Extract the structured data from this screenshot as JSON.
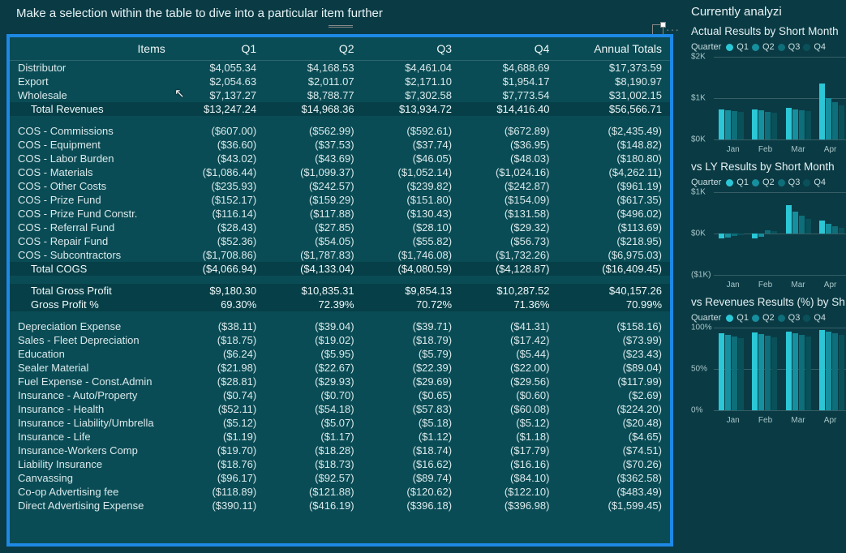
{
  "title_bar": {
    "instruction": "Make a selection within the table to dive into a particular item further"
  },
  "table": {
    "headers": [
      "Items",
      "Q1",
      "Q2",
      "Q3",
      "Q4",
      "Annual Totals"
    ],
    "sections": [
      {
        "rows": [
          {
            "label": "Distributor",
            "v": [
              "$4,055.34",
              "$4,168.53",
              "$4,461.04",
              "$4,688.69",
              "$17,373.59"
            ]
          },
          {
            "label": "Export",
            "v": [
              "$2,054.63",
              "$2,011.07",
              "$2,171.10",
              "$1,954.17",
              "$8,190.97"
            ]
          },
          {
            "label": "Wholesale",
            "v": [
              "$7,137.27",
              "$8,788.77",
              "$7,302.58",
              "$7,773.54",
              "$31,002.15"
            ]
          }
        ],
        "subtotal": {
          "label": "Total Revenues",
          "v": [
            "$13,247.24",
            "$14,968.36",
            "$13,934.72",
            "$14,416.40",
            "$56,566.71"
          ]
        }
      },
      {
        "rows": [
          {
            "label": "COS - Commissions",
            "v": [
              "($607.00)",
              "($562.99)",
              "($592.61)",
              "($672.89)",
              "($2,435.49)"
            ]
          },
          {
            "label": "COS - Equipment",
            "v": [
              "($36.60)",
              "($37.53)",
              "($37.74)",
              "($36.95)",
              "($148.82)"
            ]
          },
          {
            "label": "COS - Labor Burden",
            "v": [
              "($43.02)",
              "($43.69)",
              "($46.05)",
              "($48.03)",
              "($180.80)"
            ]
          },
          {
            "label": "COS - Materials",
            "v": [
              "($1,086.44)",
              "($1,099.37)",
              "($1,052.14)",
              "($1,024.16)",
              "($4,262.11)"
            ]
          },
          {
            "label": "COS - Other Costs",
            "v": [
              "($235.93)",
              "($242.57)",
              "($239.82)",
              "($242.87)",
              "($961.19)"
            ]
          },
          {
            "label": "COS - Prize Fund",
            "v": [
              "($152.17)",
              "($159.29)",
              "($151.80)",
              "($154.09)",
              "($617.35)"
            ]
          },
          {
            "label": "COS - Prize Fund Constr.",
            "v": [
              "($116.14)",
              "($117.88)",
              "($130.43)",
              "($131.58)",
              "($496.02)"
            ]
          },
          {
            "label": "COS - Referral Fund",
            "v": [
              "($28.43)",
              "($27.85)",
              "($28.10)",
              "($29.32)",
              "($113.69)"
            ]
          },
          {
            "label": "COS - Repair Fund",
            "v": [
              "($52.36)",
              "($54.05)",
              "($55.82)",
              "($56.73)",
              "($218.95)"
            ]
          },
          {
            "label": "COS - Subcontractors",
            "v": [
              "($1,708.86)",
              "($1,787.83)",
              "($1,746.08)",
              "($1,732.26)",
              "($6,975.03)"
            ]
          }
        ],
        "subtotal": {
          "label": "Total COGS",
          "v": [
            "($4,066.94)",
            "($4,133.04)",
            "($4,080.59)",
            "($4,128.87)",
            "($16,409.45)"
          ]
        }
      },
      {
        "rows": [],
        "subtotal": {
          "label": "Total Gross Profit",
          "v": [
            "$9,180.30",
            "$10,835.31",
            "$9,854.13",
            "$10,287.52",
            "$40,157.26"
          ]
        },
        "extra": {
          "label": "Gross Profit %",
          "v": [
            "69.30%",
            "72.39%",
            "70.72%",
            "71.36%",
            "70.99%"
          ]
        }
      },
      {
        "rows": [
          {
            "label": "Depreciation Expense",
            "v": [
              "($38.11)",
              "($39.04)",
              "($39.71)",
              "($41.31)",
              "($158.16)"
            ]
          },
          {
            "label": "Sales - Fleet Depreciation",
            "v": [
              "($18.75)",
              "($19.02)",
              "($18.79)",
              "($17.42)",
              "($73.99)"
            ]
          },
          {
            "label": "Education",
            "v": [
              "($6.24)",
              "($5.95)",
              "($5.79)",
              "($5.44)",
              "($23.43)"
            ]
          },
          {
            "label": "Sealer Material",
            "v": [
              "($21.98)",
              "($22.67)",
              "($22.39)",
              "($22.00)",
              "($89.04)"
            ]
          },
          {
            "label": "Fuel Expense - Const.Admin",
            "v": [
              "($28.81)",
              "($29.93)",
              "($29.69)",
              "($29.56)",
              "($117.99)"
            ]
          },
          {
            "label": "Insurance - Auto/Property",
            "v": [
              "($0.74)",
              "($0.70)",
              "($0.65)",
              "($0.60)",
              "($2.69)"
            ]
          },
          {
            "label": "Insurance - Health",
            "v": [
              "($52.11)",
              "($54.18)",
              "($57.83)",
              "($60.08)",
              "($224.20)"
            ]
          },
          {
            "label": "Insurance - Liability/Umbrella",
            "v": [
              "($5.12)",
              "($5.07)",
              "($5.18)",
              "($5.12)",
              "($20.48)"
            ]
          },
          {
            "label": "Insurance - Life",
            "v": [
              "($1.19)",
              "($1.17)",
              "($1.12)",
              "($1.18)",
              "($4.65)"
            ]
          },
          {
            "label": "Insurance-Workers Comp",
            "v": [
              "($19.70)",
              "($18.28)",
              "($18.74)",
              "($17.79)",
              "($74.51)"
            ]
          },
          {
            "label": "Liability Insurance",
            "v": [
              "($18.76)",
              "($18.73)",
              "($16.62)",
              "($16.16)",
              "($70.26)"
            ]
          },
          {
            "label": "Canvassing",
            "v": [
              "($96.17)",
              "($92.57)",
              "($89.74)",
              "($84.10)",
              "($362.58)"
            ]
          },
          {
            "label": "Co-op Advertising fee",
            "v": [
              "($118.89)",
              "($121.88)",
              "($120.62)",
              "($122.10)",
              "($483.49)"
            ]
          },
          {
            "label": "Direct Advertising Expense",
            "v": [
              "($390.11)",
              "($416.19)",
              "($396.18)",
              "($396.98)",
              "($1,599.45)"
            ]
          }
        ]
      }
    ]
  },
  "right": {
    "title": "Currently analyzi",
    "legend_label": "Quarter",
    "quarters": [
      "Q1",
      "Q2",
      "Q3",
      "Q4"
    ],
    "months": [
      "Jan",
      "Feb",
      "Mar",
      "Apr"
    ],
    "charts": [
      {
        "title": "Actual Results by Short Month",
        "yticks": [
          "$2K",
          "$1K",
          "$0K"
        ],
        "type": "bar",
        "series": [
          "Q1",
          "Q2",
          "Q3",
          "Q4"
        ],
        "data": {
          "Jan": [
            720,
            700,
            680,
            660
          ],
          "Feb": [
            730,
            710,
            670,
            650
          ],
          "Mar": [
            760,
            720,
            700,
            680
          ],
          "Apr": [
            1350,
            1000,
            900,
            820
          ]
        },
        "ylim": [
          0,
          2000
        ]
      },
      {
        "title": "vs LY Results by Short Month",
        "yticks": [
          "$1K",
          "$0K",
          "($1K)"
        ],
        "type": "bar-diverging",
        "series": [
          "Q1",
          "Q2",
          "Q3",
          "Q4"
        ],
        "data": {
          "Jan": [
            -120,
            -90,
            -60,
            -40
          ],
          "Feb": [
            -110,
            -70,
            80,
            60
          ],
          "Mar": [
            680,
            520,
            440,
            360
          ],
          "Apr": [
            320,
            240,
            180,
            140
          ]
        },
        "ylim": [
          -1000,
          1000
        ]
      },
      {
        "title": "vs Revenues Results (%) by Sh",
        "yticks": [
          "100%",
          "50%",
          "0%"
        ],
        "type": "bar",
        "series": [
          "Q1",
          "Q2",
          "Q3",
          "Q4"
        ],
        "data": {
          "Jan": [
            93,
            91,
            89,
            87
          ],
          "Feb": [
            94,
            92,
            90,
            88
          ],
          "Mar": [
            95,
            93,
            91,
            89
          ],
          "Apr": [
            97,
            95,
            93,
            91
          ]
        },
        "ylim": [
          0,
          100
        ]
      }
    ]
  },
  "chart_data": [
    {
      "type": "bar",
      "title": "Actual Results by Short Month",
      "xlabel": "",
      "ylabel": "",
      "categories": [
        "Jan",
        "Feb",
        "Mar",
        "Apr"
      ],
      "series": [
        {
          "name": "Q1",
          "values": [
            720,
            730,
            760,
            1350
          ]
        },
        {
          "name": "Q2",
          "values": [
            700,
            710,
            720,
            1000
          ]
        },
        {
          "name": "Q3",
          "values": [
            680,
            670,
            700,
            900
          ]
        },
        {
          "name": "Q4",
          "values": [
            660,
            650,
            680,
            820
          ]
        }
      ],
      "ylim": [
        0,
        2000
      ],
      "y_unit": "$"
    },
    {
      "type": "bar",
      "title": "vs LY Results by Short Month",
      "xlabel": "",
      "ylabel": "",
      "categories": [
        "Jan",
        "Feb",
        "Mar",
        "Apr"
      ],
      "series": [
        {
          "name": "Q1",
          "values": [
            -120,
            -110,
            680,
            320
          ]
        },
        {
          "name": "Q2",
          "values": [
            -90,
            -70,
            520,
            240
          ]
        },
        {
          "name": "Q3",
          "values": [
            -60,
            80,
            440,
            180
          ]
        },
        {
          "name": "Q4",
          "values": [
            -40,
            60,
            360,
            140
          ]
        }
      ],
      "ylim": [
        -1000,
        1000
      ],
      "y_unit": "$"
    },
    {
      "type": "bar",
      "title": "vs Revenues Results (%) by Short Month",
      "xlabel": "",
      "ylabel": "",
      "categories": [
        "Jan",
        "Feb",
        "Mar",
        "Apr"
      ],
      "series": [
        {
          "name": "Q1",
          "values": [
            93,
            94,
            95,
            97
          ]
        },
        {
          "name": "Q2",
          "values": [
            91,
            92,
            93,
            95
          ]
        },
        {
          "name": "Q3",
          "values": [
            89,
            90,
            91,
            93
          ]
        },
        {
          "name": "Q4",
          "values": [
            87,
            88,
            89,
            91
          ]
        }
      ],
      "ylim": [
        0,
        100
      ],
      "y_unit": "%"
    }
  ]
}
